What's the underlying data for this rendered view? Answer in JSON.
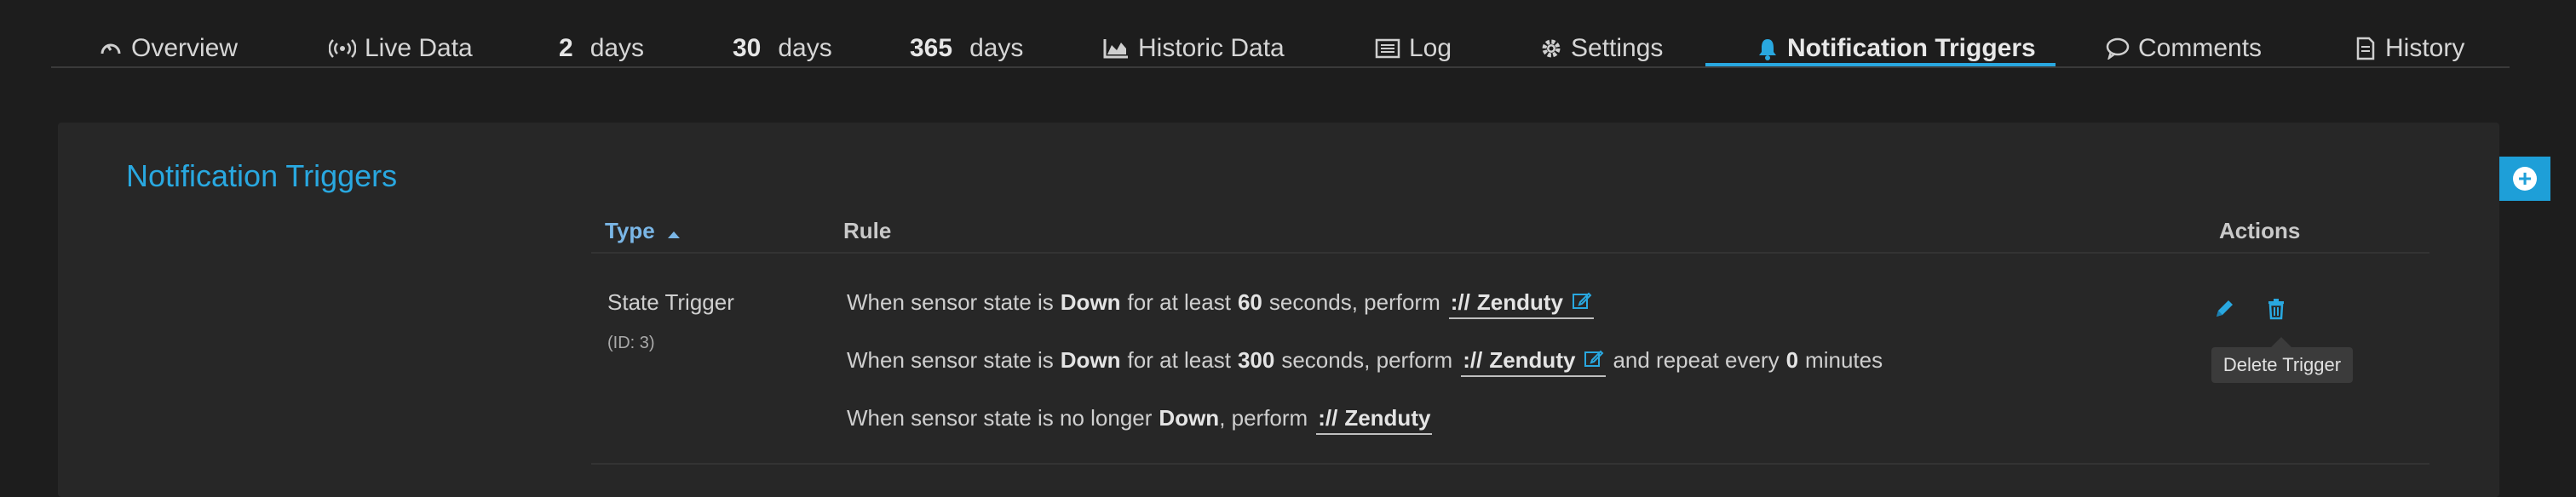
{
  "tabs": [
    {
      "label": "Overview",
      "icon": "gauge-icon"
    },
    {
      "label": "Live Data",
      "icon": "broadcast-icon"
    },
    {
      "num": "2",
      "label": "days"
    },
    {
      "num": "30",
      "label": "days"
    },
    {
      "num": "365",
      "label": "days"
    },
    {
      "label": "Historic Data",
      "icon": "area-chart-icon"
    },
    {
      "label": "Log",
      "icon": "log-list-icon"
    },
    {
      "label": "Settings",
      "icon": "gear-icon"
    },
    {
      "label": "Notification Triggers",
      "icon": "bell-icon",
      "active": true
    },
    {
      "label": "Comments",
      "icon": "comment-icon"
    },
    {
      "label": "History",
      "icon": "history-doc-icon"
    }
  ],
  "panel": {
    "title": "Notification Triggers",
    "add_button_glyph": "+"
  },
  "table": {
    "headers": {
      "type": "Type",
      "rule": "Rule",
      "actions": "Actions"
    },
    "rows": [
      {
        "type": "State Trigger",
        "id": "(ID: 3)",
        "rules": [
          {
            "p1": "When sensor state is",
            "state": "Down",
            "p2": "for at least",
            "seconds": "60",
            "p3": "seconds, perform",
            "proto": "://",
            "target": "Zenduty"
          },
          {
            "p1": "When sensor state is",
            "state": "Down",
            "p2": "for at least",
            "seconds": "300",
            "p3": "seconds, perform",
            "proto": "://",
            "target": "Zenduty",
            "p4": "and repeat every",
            "minutes": "0",
            "p5": "minutes"
          },
          {
            "p1": "When sensor state is no longer",
            "state": "Down",
            "p3": ", perform",
            "proto": "://",
            "target": "Zenduty"
          }
        ]
      }
    ]
  },
  "tooltip": "Delete Trigger",
  "colors": {
    "accent": "#29a8e0",
    "background": "#1d1d1d",
    "panel": "#272727"
  }
}
